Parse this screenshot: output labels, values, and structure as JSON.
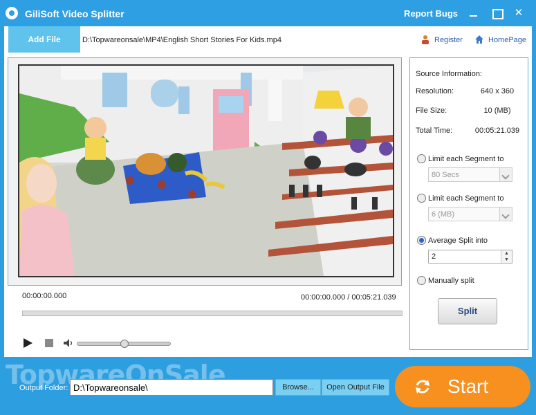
{
  "app": {
    "title": "GiliSoft Video Splitter",
    "report_bugs": "Report Bugs",
    "close_glyph": "✕"
  },
  "toolbar": {
    "add_file": "Add File",
    "file_path": "D:\\Topwareonsale\\MP4\\English Short Stories For Kids.mp4",
    "register": "Register",
    "homepage": "HomePage"
  },
  "player": {
    "current_time": "00:00:00.000",
    "position_total": "00:00:00.000 / 00:05:21.039",
    "volume": 0.5
  },
  "source": {
    "heading": "Source Information:",
    "resolution_label": "Resolution:",
    "resolution_value": "640 x 360",
    "filesize_label": "File Size:",
    "filesize_value": "10 (MB)",
    "total_time_label": "Total Time:",
    "total_time_value": "00:05:21.039"
  },
  "split_options": {
    "limit_time_label": "Limit each Segment to",
    "limit_time_value": "80 Secs",
    "limit_size_label": "Limit each Segment to",
    "limit_size_value": "6 (MB)",
    "average_label": "Average Split into",
    "average_value": "2",
    "manual_label": "Manually split",
    "selected": "average",
    "split_button": "Split"
  },
  "bottom": {
    "watermark": "TopwareOnSale",
    "output_label": "Output Folder:",
    "output_value": "D:\\Topwareonsale\\",
    "browse": "Browse...",
    "open_output": "Open Output File",
    "start": "Start"
  },
  "colors": {
    "accent": "#2e9fe2",
    "start": "#f7901e",
    "add_file": "#5fc3ec"
  }
}
